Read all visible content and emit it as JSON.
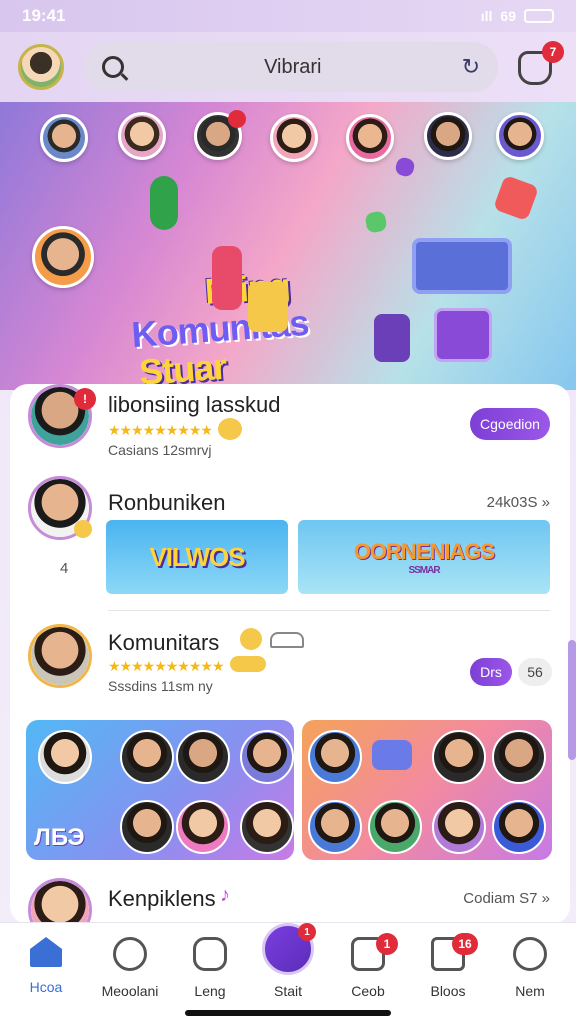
{
  "status_bar": {
    "time": "19:41",
    "signal": "ıll",
    "network": "69",
    "battery_level": "full"
  },
  "header": {
    "search_value": "Vibrari",
    "notification_count": "7",
    "icons": {
      "search": "search-icon",
      "refresh": "refresh-icon",
      "notifications": "bell-icon"
    }
  },
  "hero": {
    "title_line1": "Niing",
    "title_line2": "Komunitas",
    "title_line3": "Stuar"
  },
  "feed": {
    "posts": [
      {
        "name": "libonsiing lasskud",
        "rating": "★★★★★★★★★",
        "subtitle": "Casians 12smrvj",
        "action": "Cgoedion",
        "badge": "!"
      },
      {
        "name": "Ronbuniken",
        "side_meta": "24k03S »",
        "count": "4",
        "banner_left": "VILWOS",
        "banner_right": "OORNENIAGS",
        "banner_right_sub": "SSMAR"
      },
      {
        "name": "Komunitars",
        "rating": "★★★★★★★★★★",
        "subtitle": "Sssdins 11sm ny",
        "action_primary": "Drs",
        "action_secondary": "56"
      },
      {
        "grid_left_caption": "ЛБЭ"
      },
      {
        "name": "Kenpiklens",
        "side_meta": "Codiam S7 »"
      }
    ]
  },
  "bottom_nav": {
    "items": [
      {
        "label": "Hcoa",
        "icon": "home-icon",
        "active": true
      },
      {
        "label": "Meoolani",
        "icon": "explore-icon"
      },
      {
        "label": "Leng",
        "icon": "chat-icon"
      },
      {
        "label": "Stait",
        "icon": "create-icon",
        "badge": "1"
      },
      {
        "label": "Ceob",
        "icon": "music-icon",
        "badge": "1"
      },
      {
        "label": "Bloos",
        "icon": "inbox-icon",
        "badge": "16"
      },
      {
        "label": "Nem",
        "icon": "profile-icon"
      }
    ]
  },
  "colors": {
    "accent": "#7e3fd6",
    "badge": "#e02b3b",
    "active_nav": "#3a6fd6",
    "star": "#f3b81a"
  }
}
